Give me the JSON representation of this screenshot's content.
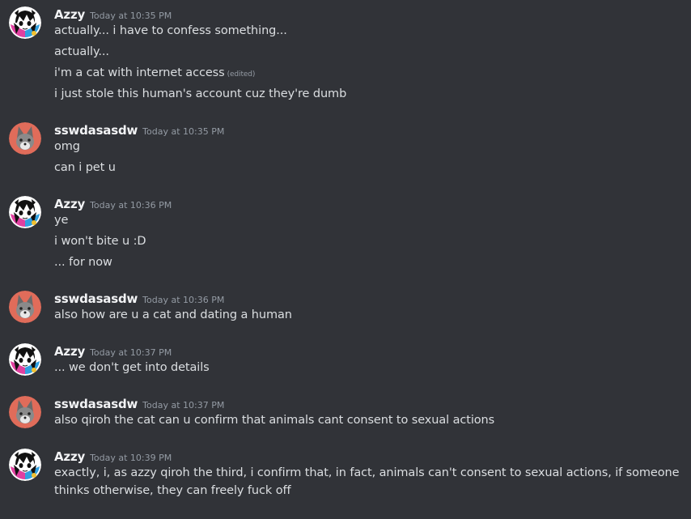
{
  "colors": {
    "background": "#313338",
    "username": "#f2f3f5",
    "text": "#dbdee1",
    "muted": "#949ba4",
    "fox_avatar_bg": "#e06c5a"
  },
  "messages": [
    {
      "author": "Azzy",
      "timestamp": "Today at 10:35 PM",
      "avatar_icon": "anime-girl-avatar-icon",
      "lines": [
        "actually... i have to confess something...",
        "actually...",
        "i'm a cat with internet access",
        "i just stole this human's account cuz they're dumb"
      ],
      "edited_label": "(edited)"
    },
    {
      "author": "sswdasasdw",
      "timestamp": "Today at 10:35 PM",
      "avatar_icon": "fox-avatar-icon",
      "lines": [
        "omg",
        "can i pet u"
      ]
    },
    {
      "author": "Azzy",
      "timestamp": "Today at 10:36 PM",
      "avatar_icon": "anime-girl-avatar-icon",
      "lines": [
        "ye",
        "i won't bite u :D",
        "... for now"
      ]
    },
    {
      "author": "sswdasasdw",
      "timestamp": "Today at 10:36 PM",
      "avatar_icon": "fox-avatar-icon",
      "lines": [
        "also how are u a cat and dating a human"
      ]
    },
    {
      "author": "Azzy",
      "timestamp": "Today at 10:37 PM",
      "avatar_icon": "anime-girl-avatar-icon",
      "lines": [
        "... we don't get into details"
      ]
    },
    {
      "author": "sswdasasdw",
      "timestamp": "Today at 10:37 PM",
      "avatar_icon": "fox-avatar-icon",
      "lines": [
        "also qiroh the cat can u confirm that animals cant consent to sexual actions"
      ]
    },
    {
      "author": "Azzy",
      "timestamp": "Today at 10:39 PM",
      "avatar_icon": "anime-girl-avatar-icon",
      "lines": [
        "exactly, i, as azzy qiroh the third, i confirm that, in fact, animals can't consent to sexual actions, if someone thinks otherwise, they can freely fuck off"
      ]
    }
  ]
}
